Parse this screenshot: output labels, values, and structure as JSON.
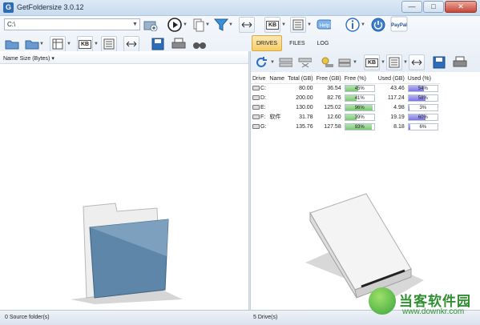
{
  "window": {
    "title": "GetFoldersize 3.0.12",
    "app_icon_glyph": "G",
    "minimize_glyph": "—",
    "maximize_glyph": "□",
    "close_glyph": "✕"
  },
  "path_input": {
    "value": "C:\\"
  },
  "tabs": [
    {
      "label": "DRIVES",
      "active": true
    },
    {
      "label": "FILES",
      "active": false
    },
    {
      "label": "LOG",
      "active": false
    }
  ],
  "toolbar": {
    "kb_label": "KB",
    "help_label": "Help",
    "paypal_label": "PayPal"
  },
  "left_pane": {
    "columns": [
      "Name",
      "Size (Bytes)"
    ]
  },
  "drives": {
    "columns": [
      "Drive",
      "Name",
      "Total (GB)",
      "Free (GB)",
      "Free (%)",
      "Used (GB)",
      "Used (%)"
    ],
    "rows": [
      {
        "drive": "C:",
        "name": "",
        "total": "80.00",
        "free": "36.54",
        "free_pct": "45%",
        "used": "43.46",
        "used_pct": "54%",
        "free_frac": 0.45,
        "used_frac": 0.54
      },
      {
        "drive": "D:",
        "name": "",
        "total": "200.00",
        "free": "82.76",
        "free_pct": "41%",
        "used": "117.24",
        "used_pct": "58%",
        "free_frac": 0.41,
        "used_frac": 0.58
      },
      {
        "drive": "E:",
        "name": "",
        "total": "130.00",
        "free": "125.02",
        "free_pct": "96%",
        "used": "4.98",
        "used_pct": "3%",
        "free_frac": 0.96,
        "used_frac": 0.03
      },
      {
        "drive": "F:",
        "name": "软件",
        "total": "31.78",
        "free": "12.60",
        "free_pct": "39%",
        "used": "19.19",
        "used_pct": "60%",
        "free_frac": 0.39,
        "used_frac": 0.6
      },
      {
        "drive": "G:",
        "name": "",
        "total": "135.76",
        "free": "127.58",
        "free_pct": "93%",
        "used": "8.18",
        "used_pct": "6%",
        "free_frac": 0.93,
        "used_frac": 0.06
      }
    ]
  },
  "status": {
    "left": "0 Source folder(s)",
    "right": "5 Drive(s)"
  },
  "watermark": {
    "brand": "当客软件园",
    "url": "www.downkr.com"
  },
  "colors": {
    "free_bar": "#7cc874",
    "used_bar": "#7c74e6",
    "active_tab": "#f6cd6a",
    "title_bar": "#c9dbef"
  },
  "icons": [
    "folder-add-icon",
    "play-icon",
    "copy-icon",
    "filter-icon",
    "expand-width-icon",
    "list-icon",
    "help-icon",
    "info-icon",
    "power-icon",
    "paypal-icon",
    "open-folder-icon",
    "save-icon",
    "print-icon",
    "find-icon",
    "refresh-icon",
    "network-drive-icon",
    "tree-icon",
    "settings-icon",
    "folder-illustration",
    "drive-illustration"
  ]
}
